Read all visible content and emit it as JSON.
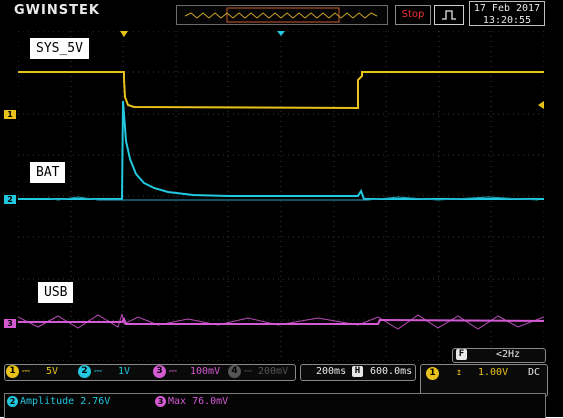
{
  "header": {
    "brand": "GWINSTEK",
    "run_state": "Stop",
    "trigger_icon": "pulse-edge-icon",
    "date": "17 Feb 2017",
    "time": "13:20:55"
  },
  "channels": [
    {
      "id": "1",
      "label": "SYS_5V",
      "color": "#e8c21a",
      "scale": "5V"
    },
    {
      "id": "2",
      "label": "BAT",
      "color": "#22c8e0",
      "scale": "1V"
    },
    {
      "id": "3",
      "label": "USB",
      "color": "#d45ad4",
      "scale": "100mV"
    },
    {
      "id": "4",
      "label": "",
      "color": "#555555",
      "scale": "200mV"
    }
  ],
  "timebase": {
    "scale": "200ms",
    "position_icon": "H",
    "position": "600.0ms"
  },
  "trigger": {
    "freq_icon": "F",
    "frequency": "<2Hz",
    "channel": "1",
    "level": "1.00V",
    "coupling": "DC"
  },
  "measurements": [
    {
      "channel": "2",
      "text": "Amplitude 2.76V"
    },
    {
      "channel": "3",
      "text": "Max 76.0mV"
    }
  ],
  "colors": {
    "grid": "#3a3a3a",
    "panel": "#000000"
  }
}
